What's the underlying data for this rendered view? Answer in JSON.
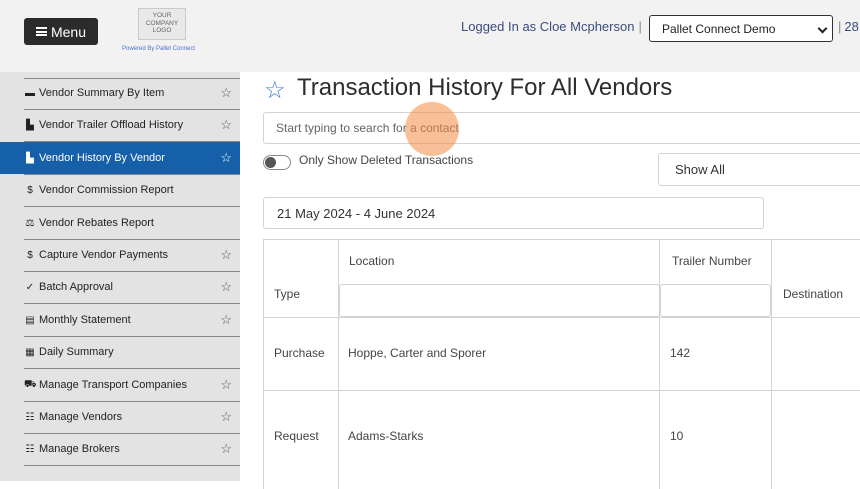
{
  "header": {
    "menu_label": "Menu",
    "logo_text": "YOUR COMPANY LOGO",
    "powered_by": "Powered By Pallet Connect",
    "logged_in": "Logged In as Cloe Mcpherson",
    "separator": "|",
    "org_selected": "Pallet Connect Demo",
    "extra_text": "28"
  },
  "sidebar": {
    "items": [
      {
        "icon": "barcode-icon",
        "glyph": "▬",
        "label": "Vendor Summary By Item",
        "starred": true
      },
      {
        "icon": "chart-icon",
        "glyph": "▙",
        "label": "Vendor Trailer Offload History",
        "starred": true
      },
      {
        "icon": "chart-icon",
        "glyph": "▙",
        "label": "Vendor History By Vendor",
        "starred": true,
        "active": true
      },
      {
        "icon": "dollar-icon",
        "glyph": "$",
        "label": "Vendor Commission Report",
        "starred": false
      },
      {
        "icon": "balance-icon",
        "glyph": "⚖",
        "label": "Vendor Rebates Report",
        "starred": false
      },
      {
        "icon": "dollar-icon",
        "glyph": "$",
        "label": "Capture Vendor Payments",
        "starred": true
      },
      {
        "icon": "check-icon",
        "glyph": "✓",
        "label": "Batch Approval",
        "starred": true
      },
      {
        "icon": "statement-icon",
        "glyph": "▤",
        "label": "Monthly Statement",
        "starred": true
      },
      {
        "icon": "calendar-icon",
        "glyph": "▦",
        "label": "Daily Summary",
        "starred": false
      },
      {
        "icon": "truck-icon",
        "glyph": "⛟",
        "label": "Manage Transport Companies",
        "starred": true
      },
      {
        "icon": "users-icon",
        "glyph": "☷",
        "label": "Manage Vendors",
        "starred": true
      },
      {
        "icon": "users-icon",
        "glyph": "☷",
        "label": "Manage Brokers",
        "starred": true
      }
    ]
  },
  "main": {
    "title": "Transaction History For All Vendors",
    "search_placeholder": "Start typing to search for a contact",
    "toggle_label": "Only Show Deleted Transactions",
    "show_filter": "Show All",
    "date_range": "21 May 2024 - 4 June 2024",
    "table": {
      "headers": {
        "type": "Type",
        "location": "Location",
        "trailer": "Trailer Number",
        "destination": "Destination"
      },
      "rows": [
        {
          "type": "Purchase",
          "location": "Hoppe, Carter and Sporer",
          "trailer": "142",
          "destination": ""
        },
        {
          "type": "Request",
          "location": "Adams-Starks",
          "trailer": "10",
          "destination": ""
        }
      ]
    }
  },
  "colors": {
    "accent": "#1560a8",
    "star": "#3a7fd2",
    "cursor_highlight": "#f28b43"
  }
}
